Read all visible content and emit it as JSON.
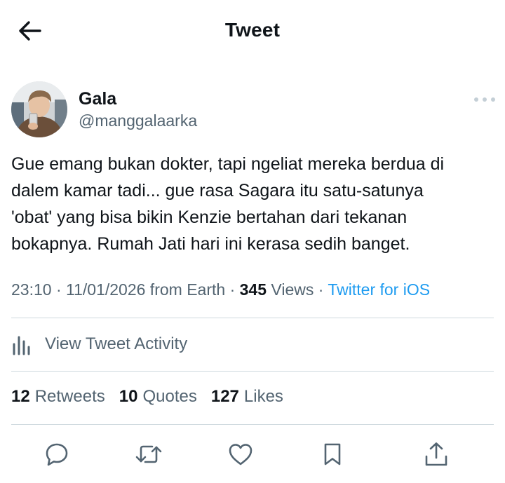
{
  "header": {
    "title": "Tweet",
    "back_icon": "arrow-left-icon"
  },
  "author": {
    "display_name": "Gala",
    "handle": "@manggalaarka",
    "more_icon": "more-horizontal-icon"
  },
  "tweet": {
    "text": "Gue emang bukan dokter, tapi ngeliat mereka berdua di\ndalem kamar tadi... gue rasa Sagara itu satu-satunya\n'obat' yang bisa bikin Kenzie bertahan dari tekanan\nbokapnya. Rumah Jati hari ini kerasa sedih banget."
  },
  "meta": {
    "time": "23:10",
    "date": "11/01/2026 from Earth",
    "views_count": "345",
    "views_label": "Views",
    "source": "Twitter for iOS"
  },
  "activity": {
    "label": "View Tweet Activity",
    "icon": "analytics-bars-icon"
  },
  "stats": {
    "retweets": {
      "count": "12",
      "label": "Retweets"
    },
    "quotes": {
      "count": "10",
      "label": "Quotes"
    },
    "likes": {
      "count": "127",
      "label": "Likes"
    }
  },
  "actions": [
    "reply-icon",
    "retweet-icon",
    "like-icon",
    "bookmark-icon",
    "share-icon"
  ],
  "colors": {
    "text": "#0f1419",
    "secondary": "#536471",
    "link": "#1d9bf0",
    "divider": "#cfd9de"
  }
}
